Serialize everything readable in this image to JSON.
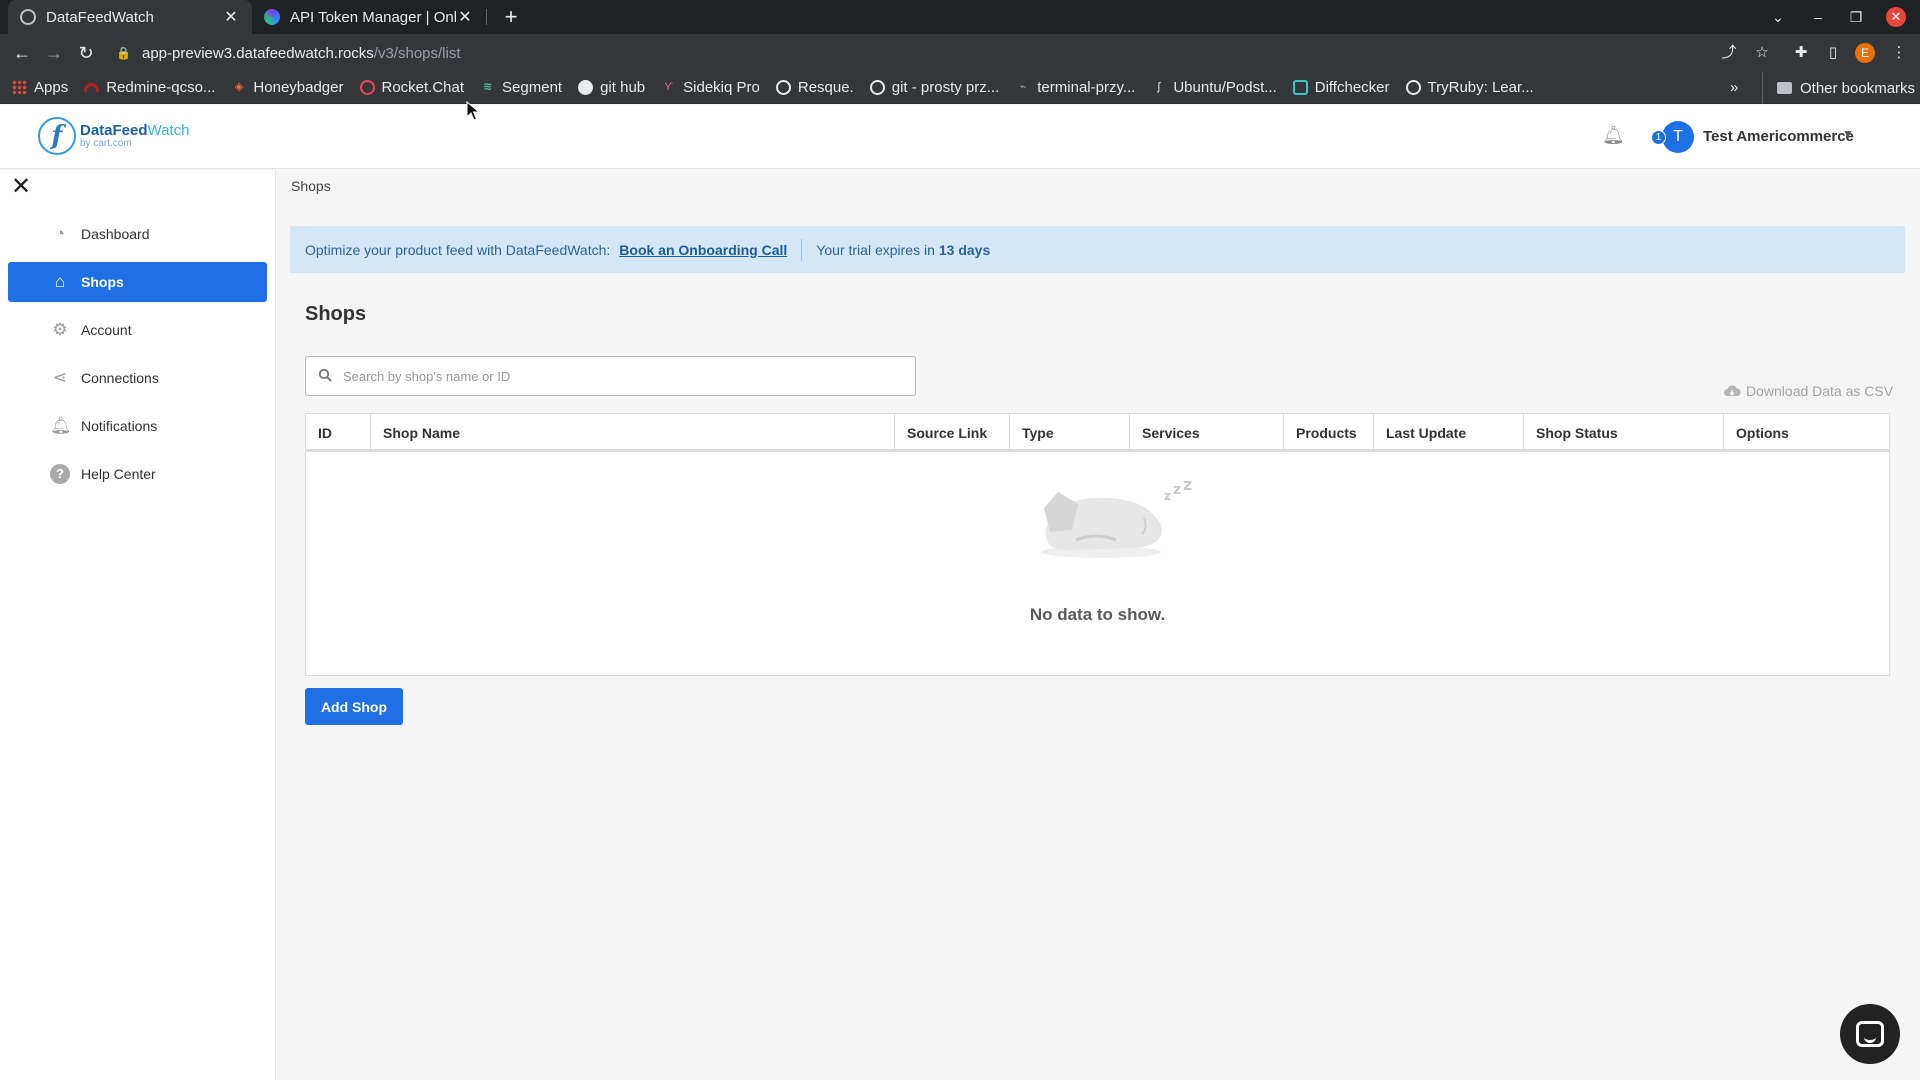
{
  "browser": {
    "tabs": [
      {
        "title": "DataFeedWatch",
        "active": true
      },
      {
        "title": "API Token Manager | Onli",
        "active": false
      }
    ],
    "url": {
      "host": "app-preview3.datafeedwatch.rocks",
      "path": "/v3/shops/list"
    },
    "profile_initial": "E",
    "bookmarks": [
      {
        "label": "Apps",
        "icon": "apps-grid-icon",
        "color": "#e8453c"
      },
      {
        "label": "Redmine-qcso...",
        "icon": "redmine-icon",
        "color": "#b32024"
      },
      {
        "label": "Honeybadger",
        "icon": "honeybadger-icon",
        "color": "#ff6a3d"
      },
      {
        "label": "Rocket.Chat",
        "icon": "rocket-chat-icon",
        "color": "#f5455c"
      },
      {
        "label": "Segment",
        "icon": "segment-icon",
        "color": "#52bd95"
      },
      {
        "label": "git hub",
        "icon": "github-icon",
        "color": "#e8eaed"
      },
      {
        "label": "Sidekiq Pro",
        "icon": "sidekiq-icon",
        "color": "#b1003e"
      },
      {
        "label": "Resque.",
        "icon": "globe-icon",
        "color": "#e8eaed"
      },
      {
        "label": "git - prosty prz...",
        "icon": "globe-icon",
        "color": "#e8eaed"
      },
      {
        "label": "terminal-przy...",
        "icon": "terminal-icon",
        "color": "#9aa0a6"
      },
      {
        "label": "Ubuntu/Podst...",
        "icon": "ubuntu-icon",
        "color": "#e95420"
      },
      {
        "label": "Diffchecker",
        "icon": "diffchecker-icon",
        "color": "#3ec6c0"
      },
      {
        "label": "TryRuby: Lear...",
        "icon": "globe-icon",
        "color": "#e8eaed"
      }
    ],
    "bookmarks_more": "»",
    "other_bookmarks": "Other bookmarks"
  },
  "header": {
    "logo_name_1": "DataFeed",
    "logo_name_2": "Watch",
    "logo_sub": "by cart.com",
    "user_initial": "T",
    "user_badge": "1",
    "user_name": "Test Americommerce"
  },
  "sidebar": {
    "items": [
      {
        "label": "Dashboard",
        "icon": "dashboard-icon",
        "active": false
      },
      {
        "label": "Shops",
        "icon": "shop-icon",
        "active": true
      },
      {
        "label": "Account",
        "icon": "gear-icon",
        "active": false
      },
      {
        "label": "Connections",
        "icon": "connections-icon",
        "active": false
      },
      {
        "label": "Notifications",
        "icon": "bell-icon",
        "active": false
      },
      {
        "label": "Help Center",
        "icon": "help-icon",
        "active": false
      }
    ]
  },
  "main": {
    "breadcrumb": "Shops",
    "banner": {
      "text": "Optimize your product feed with DataFeedWatch:",
      "link": "Book an Onboarding Call",
      "trial_prefix": "Your trial expires in",
      "trial_days": "13 days"
    },
    "title": "Shops",
    "search": {
      "placeholder": "Search by shop's name or ID",
      "value": ""
    },
    "csv_label": "Download Data as CSV",
    "table": {
      "columns": [
        "ID",
        "Shop Name",
        "Source Link",
        "Type",
        "Services",
        "Products",
        "Last Update",
        "Shop Status",
        "Options"
      ],
      "empty_text": "No data to show."
    },
    "add_shop_label": "Add Shop"
  },
  "colors": {
    "primary": "#1f6fe5",
    "banner_bg": "#d4e7f8",
    "page_bg": "#f5f5f5"
  }
}
